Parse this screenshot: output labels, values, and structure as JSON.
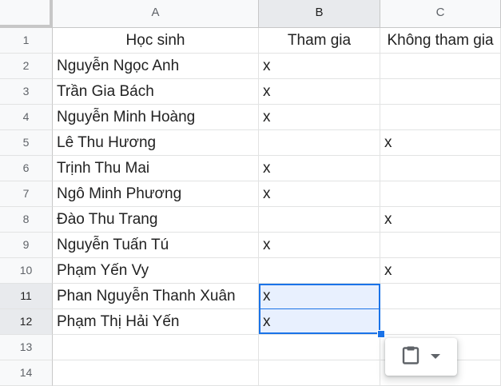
{
  "columns": [
    "A",
    "B",
    "C"
  ],
  "rows": [
    {
      "num": "1",
      "a": "Học sinh",
      "b": "Tham gia",
      "c": "Không tham gia"
    },
    {
      "num": "2",
      "a": "Nguyễn Ngọc Anh",
      "b": "x",
      "c": ""
    },
    {
      "num": "3",
      "a": "Trần Gia Bách",
      "b": "x",
      "c": ""
    },
    {
      "num": "4",
      "a": "Nguyễn Minh Hoàng",
      "b": "x",
      "c": ""
    },
    {
      "num": "5",
      "a": "Lê Thu Hương",
      "b": "",
      "c": "x"
    },
    {
      "num": "6",
      "a": "Trịnh Thu Mai",
      "b": "x",
      "c": ""
    },
    {
      "num": "7",
      "a": "Ngô Minh Phương",
      "b": "x",
      "c": ""
    },
    {
      "num": "8",
      "a": "Đào Thu Trang",
      "b": "",
      "c": "x"
    },
    {
      "num": "9",
      "a": "Nguyễn Tuấn Tú",
      "b": "x",
      "c": ""
    },
    {
      "num": "10",
      "a": "Phạm Yến Vy",
      "b": "",
      "c": "x"
    },
    {
      "num": "11",
      "a": "Phan Nguyễn Thanh Xuân",
      "b": "x",
      "c": ""
    },
    {
      "num": "12",
      "a": "Phạm Thị Hải Yến",
      "b": "x",
      "c": ""
    },
    {
      "num": "13",
      "a": "",
      "b": "",
      "c": ""
    },
    {
      "num": "14",
      "a": "",
      "b": "",
      "c": ""
    }
  ],
  "selection": {
    "column": "B",
    "rows": [
      "11",
      "12"
    ]
  },
  "paste_options": {
    "icon": "clipboard-icon",
    "menu_icon": "chevron-down-icon"
  },
  "colors": {
    "selection_border": "#1a73e8",
    "selection_fill": "#e8f0fe",
    "header_bg": "#f8f9fa"
  }
}
